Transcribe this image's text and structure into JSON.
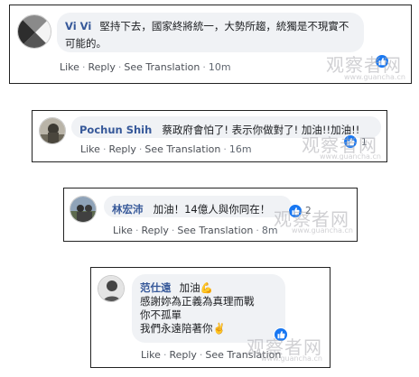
{
  "comments": [
    {
      "name": "Vi Vi",
      "text": "堅持下去，國家終將統一，大勢所趨，統獨是不現實不可能的。",
      "actions": {
        "like": "Like",
        "reply": "Reply",
        "translate": "See Translation",
        "time": "10m"
      },
      "reaction_count": "",
      "reaction_icon": "like-icon"
    },
    {
      "name": "Pochun Shih",
      "text": "蔡政府會怕了! 表示你做對了! 加油!!加油!!",
      "actions": {
        "like": "Like",
        "reply": "Reply",
        "translate": "See Translation",
        "time": "16m"
      },
      "reaction_count": "1",
      "reaction_icon": "like-icon"
    },
    {
      "name": "林宏沛",
      "text": "加油！14億人與你同在！",
      "actions": {
        "like": "Like",
        "reply": "Reply",
        "translate": "See Translation",
        "time": "8m"
      },
      "reaction_count": "2",
      "reaction_icon": "like-icon"
    },
    {
      "name": "范仕遠",
      "text_line1": "加油💪",
      "text_line2": "感謝妳為正義為真理而戰",
      "text_line3": "你不孤單",
      "text_line4": "我們永遠陪著你✌️",
      "actions": {
        "like": "Like",
        "reply": "Reply",
        "translate": "See Translation"
      },
      "reaction_count": "",
      "reaction_icon": "like-icon"
    }
  ],
  "watermark": {
    "text": "观察者网",
    "url": "www.guancha.cn"
  },
  "colors": {
    "name": "#365899",
    "bubble": "#f0f2f5",
    "like": "#1877f2"
  }
}
